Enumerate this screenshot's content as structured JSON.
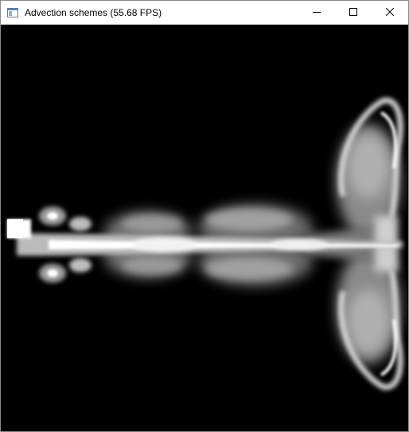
{
  "window": {
    "title": "Advection schemes (55.68 FPS)"
  },
  "titlebar": {
    "app_icon": "app-window-icon",
    "minimize_icon": "minimize-icon",
    "maximize_icon": "maximize-icon",
    "close_icon": "close-icon"
  },
  "canvas": {
    "background": "#000000",
    "fluid_color": "#ffffff",
    "description_icon": "smoke-simulation"
  },
  "colors": {
    "titlebar_bg": "#ffffff",
    "close_hover": "#e81123"
  }
}
